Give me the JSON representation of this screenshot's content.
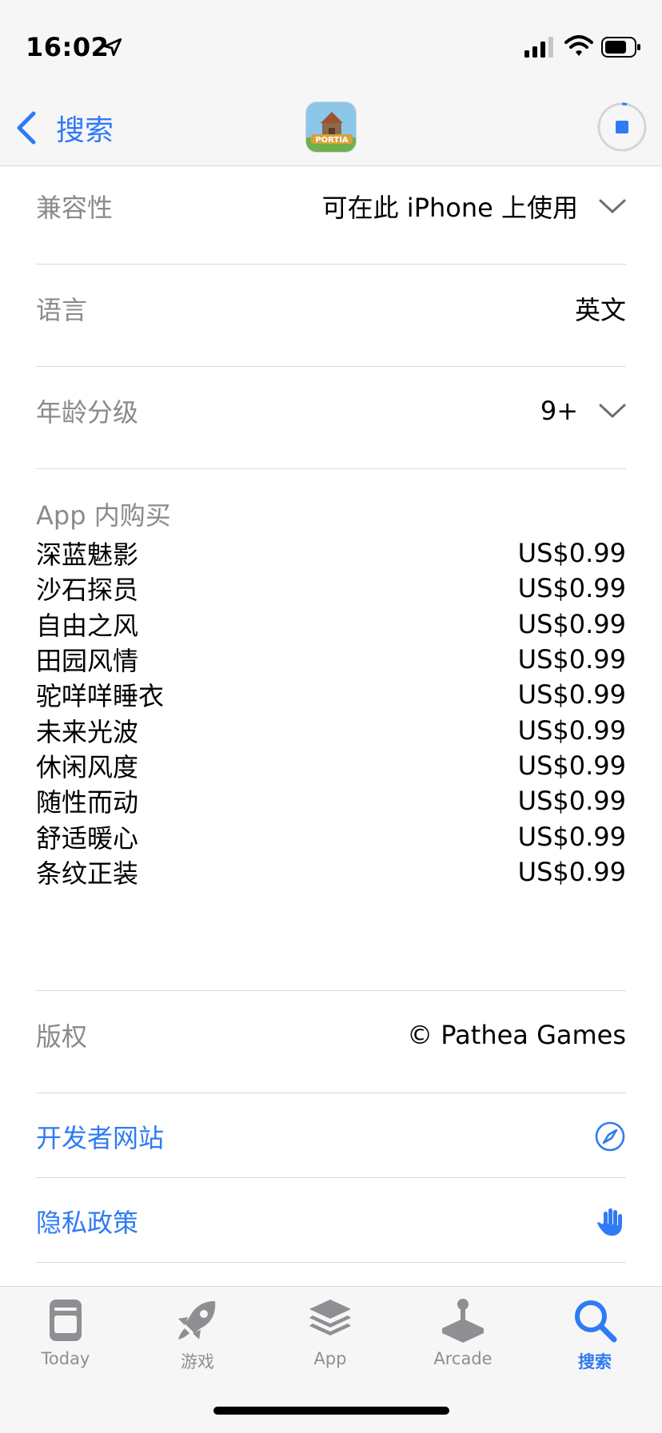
{
  "status": {
    "time": "16:02"
  },
  "nav": {
    "back_label": "搜索",
    "app_icon_text": "PORTIA"
  },
  "rows": {
    "compatibility": {
      "label": "兼容性",
      "value": "可在此 iPhone 上使用"
    },
    "language": {
      "label": "语言",
      "value": "英文"
    },
    "age_rating": {
      "label": "年龄分级",
      "value": "9+"
    }
  },
  "iap": {
    "title": "App 内购买",
    "items": [
      {
        "name": "深蓝魅影",
        "price": "US$0.99"
      },
      {
        "name": "沙石探员",
        "price": "US$0.99"
      },
      {
        "name": "自由之风",
        "price": "US$0.99"
      },
      {
        "name": "田园风情",
        "price": "US$0.99"
      },
      {
        "name": "驼咩咩睡衣",
        "price": "US$0.99"
      },
      {
        "name": "未来光波",
        "price": "US$0.99"
      },
      {
        "name": "休闲风度",
        "price": "US$0.99"
      },
      {
        "name": "随性而动",
        "price": "US$0.99"
      },
      {
        "name": "舒适暖心",
        "price": "US$0.99"
      },
      {
        "name": "条纹正装",
        "price": "US$0.99"
      }
    ]
  },
  "copyright": {
    "label": "版权",
    "value": "© Pathea Games"
  },
  "links": {
    "developer_site": {
      "label": "开发者网站",
      "icon": "compass-icon"
    },
    "privacy_policy": {
      "label": "隐私政策",
      "icon": "hand-icon"
    }
  },
  "tabs": [
    {
      "label": "Today",
      "icon": "today-icon"
    },
    {
      "label": "游戏",
      "icon": "rocket-icon"
    },
    {
      "label": "App",
      "icon": "app-stack-icon"
    },
    {
      "label": "Arcade",
      "icon": "joystick-icon"
    },
    {
      "label": "搜索",
      "icon": "search-icon",
      "active": true
    }
  ],
  "colors": {
    "accent": "#2f7bf5",
    "secondary_text": "#8a8a8e",
    "bar_background": "#f6f6f7"
  }
}
